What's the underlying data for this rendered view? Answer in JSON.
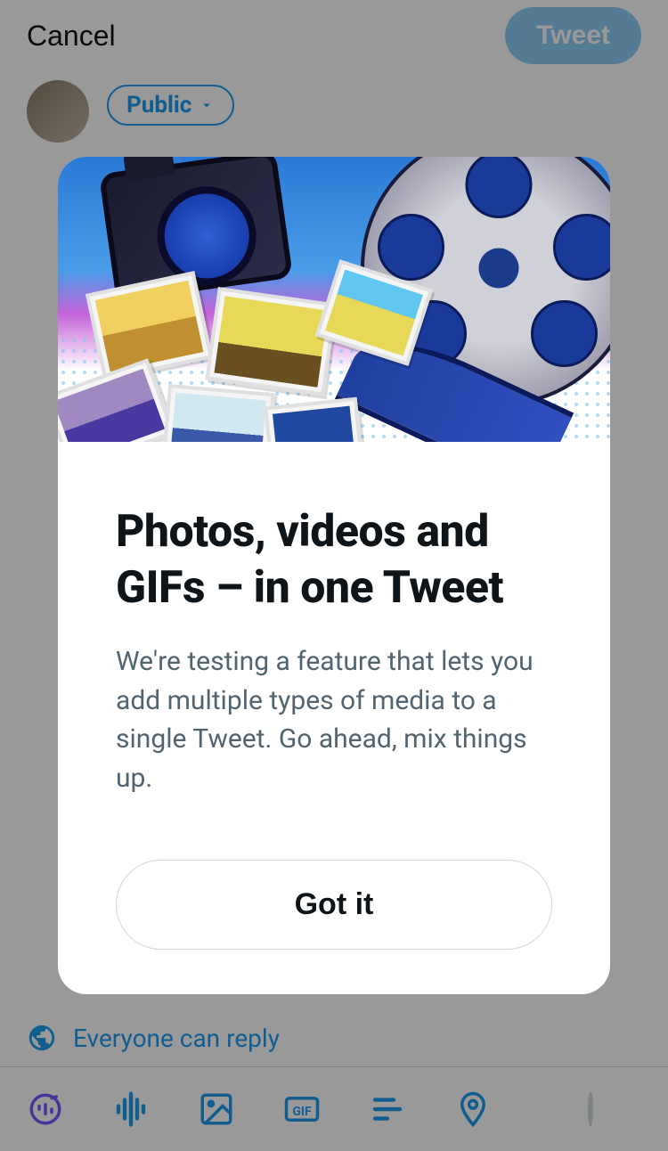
{
  "header": {
    "cancel_label": "Cancel",
    "tweet_label": "Tweet"
  },
  "compose": {
    "audience_label": "Public"
  },
  "reply": {
    "label": "Everyone can reply"
  },
  "modal": {
    "title": "Photos, videos and GIFs – in one Tweet",
    "description": "We're testing a feature that lets you add multiple types of media to a single Tweet. Go ahead, mix things up.",
    "confirm_label": "Got it"
  }
}
